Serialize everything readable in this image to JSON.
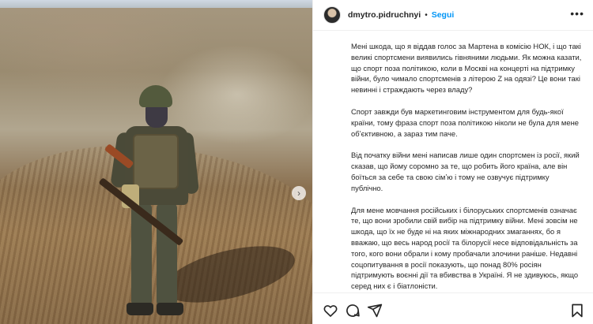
{
  "post": {
    "username": "dmytro.pidruchnyi",
    "separator": "•",
    "follow_label": "Segui",
    "more_label": "•••",
    "carousel_next": "›",
    "caption": [
      "Мені шкода, що я віддав голос за Мартена в комісію НОК, і що такі великі спортсмени виявились гівняними людьми. Як можна казати, що спорт поза політикою, коли в Москві на концерті на підтримку війни, було чимало спортсменів з літерою Z на одязі? Це вони такі невинні і страждають через владу?",
      "Спорт завжди був маркетинговим інструментом для будь-якої країни, тому фраза спорт поза політикою ніколи не була для мене обʼєктивною, а зараз тим паче.",
      "Від початку війни мені написав лише один спортсмен із росії, який сказав, що йому соромно за те, що робить його країна, але він боїться за себе та свою сімʼю і тому не озвучує підтримку публічно.",
      "Для мене мовчання російських і білоруських спортсменів означає те, що вони зробили свій вибір на підтримку війни. Мені зовсім не шкода, що їх не буде ні на яких міжнародних змаганнях, бо я вважаю, що весь народ росії та білорусії несе відповідальність за того, кого вони обрали і кому пробачали злочини раніше. Недавні соцопитування в росії показують, що понад 80% росіян підтримують воєнні дії та вбивства в Україні. Я не здивуюсь, якщо серед них є і біатлоністи."
    ]
  },
  "icons": {
    "like": "heart-icon",
    "comment": "comment-icon",
    "share": "share-icon",
    "save": "bookmark-icon",
    "avatar": "avatar",
    "next": "chevron-right-icon"
  },
  "colors": {
    "accent": "#0095f6",
    "text": "#262626",
    "divider": "#efefef"
  }
}
